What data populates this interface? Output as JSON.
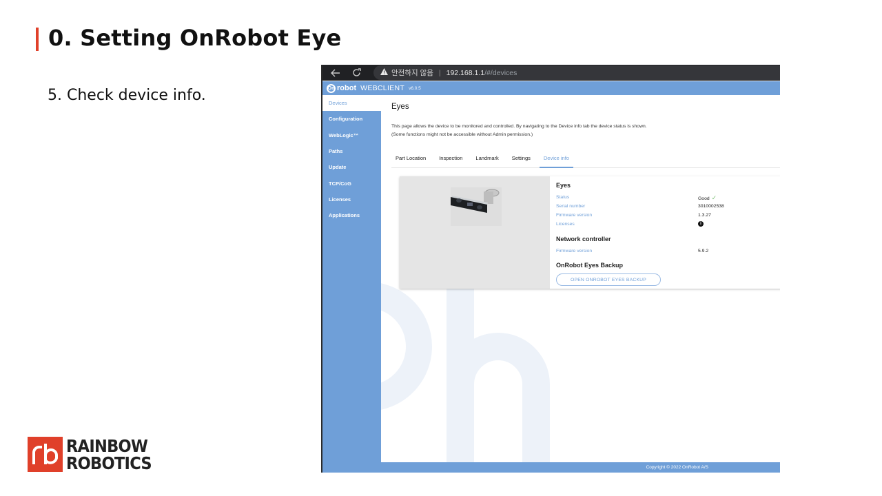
{
  "slide": {
    "title": "0. Setting OnRobot Eye",
    "step": "5. Check device info.",
    "logo": {
      "line1": "RAINBOW",
      "line2": "ROBOTICS",
      "accent": "#e0402a"
    }
  },
  "browser": {
    "warning_text": "안전하지 않음",
    "url_host": "192.168.1.1",
    "url_path": "/#/devices"
  },
  "app": {
    "brand": "robot",
    "brand_mark": "On",
    "name": "WEBCLIENT",
    "version": "v6.0.5",
    "accent": "#6f9fd8",
    "sidebar": [
      {
        "label": "Devices",
        "active": true
      },
      {
        "label": "Configuration"
      },
      {
        "label": "WebLogic™"
      },
      {
        "label": "Paths"
      },
      {
        "label": "Update"
      },
      {
        "label": "TCP/CoG"
      },
      {
        "label": "Licenses"
      },
      {
        "label": "Applications"
      }
    ],
    "page_title": "Eyes",
    "description_1": "This page allows the device to be monitored and controlled. By navigating to the Device info tab the device status is shown.",
    "description_2": "(Some functions might not be accessible without Admin permission.)",
    "tabs": [
      {
        "label": "Part Location"
      },
      {
        "label": "Inspection"
      },
      {
        "label": "Landmark"
      },
      {
        "label": "Settings"
      },
      {
        "label": "Device info",
        "active": true
      }
    ],
    "device": {
      "section_eyes": "Eyes",
      "status_label": "Status",
      "status_value": "Good",
      "serial_label": "Serial number",
      "serial_value": "3010002538",
      "firmware_label": "Firmware version",
      "firmware_value": "1.3.27",
      "licenses_label": "Licenses",
      "section_network": "Network controller",
      "net_firmware_label": "Firmware version",
      "net_firmware_value": "5.9.2",
      "section_backup": "OnRobot Eyes Backup",
      "backup_button": "OPEN ONROBOT EYES BACKUP"
    },
    "footer": "Copyright © 2022 OnRobot A/S"
  }
}
